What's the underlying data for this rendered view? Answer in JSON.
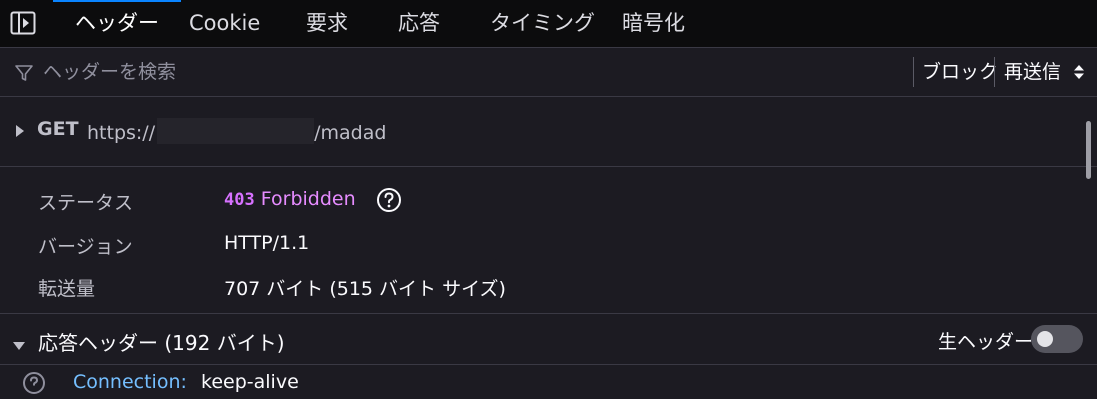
{
  "tabs": [
    {
      "label": "ヘッダー",
      "selected": true
    },
    {
      "label": "Cookie"
    },
    {
      "label": "要求"
    },
    {
      "label": "応答"
    },
    {
      "label": "タイミング"
    },
    {
      "label": "暗号化"
    }
  ],
  "filter": {
    "placeholder": "ヘッダーを検索"
  },
  "toolbar": {
    "block_label": "ブロック",
    "resend_label": "再送信"
  },
  "request": {
    "method": "GET",
    "url_prefix": "https://",
    "url_suffix": "/madad"
  },
  "summary": {
    "status_label": "ステータス",
    "status_code": "403",
    "status_text": "Forbidden",
    "version_label": "バージョン",
    "version_value": "HTTP/1.1",
    "transferred_label": "転送量",
    "transferred_value": "707 バイト (515 バイト サイズ)"
  },
  "response_headers": {
    "title": "応答ヘッダー (192 バイト)",
    "raw_label": "生ヘッダー",
    "raw_enabled": false,
    "rows": [
      {
        "name": "Connection:",
        "value": "keep-alive"
      }
    ]
  },
  "colors": {
    "accent": "#0a84ff",
    "status_code": "#d671ff",
    "header_name": "#75bfff",
    "background": "#1c1b22"
  },
  "icons": [
    "panel-toggle-icon",
    "filter-icon",
    "updown-arrows-icon",
    "triangle-right-icon",
    "help-circle-icon",
    "triangle-down-icon",
    "help-icon"
  ]
}
